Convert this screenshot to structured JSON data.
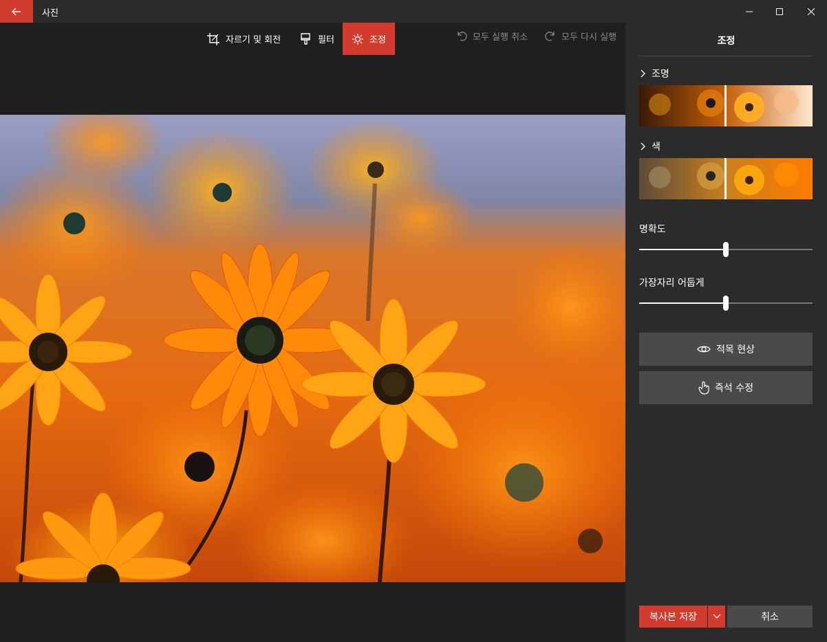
{
  "window": {
    "title": "사진"
  },
  "toolbar": {
    "tabs": [
      {
        "label": "자르기 및 회전",
        "icon": "crop-icon"
      },
      {
        "label": "필터",
        "icon": "brush-icon"
      },
      {
        "label": "조정",
        "icon": "sun-icon",
        "active": true
      }
    ],
    "undo_all": "모두 실행 취소",
    "redo_all": "모두 다시 실행"
  },
  "panel": {
    "title": "조정",
    "sections": [
      {
        "label": "조명",
        "icon": "chevron-right-icon"
      },
      {
        "label": "색",
        "icon": "chevron-right-icon"
      }
    ],
    "sliders": [
      {
        "label": "명확도",
        "value": 50
      },
      {
        "label": "가장자리 어둡게",
        "value": 50
      }
    ],
    "buttons": [
      {
        "label": "적목 현상",
        "icon": "eye-icon"
      },
      {
        "label": "즉석 수정",
        "icon": "touch-icon"
      }
    ],
    "save_copy": "복사본 저장",
    "cancel": "취소"
  },
  "colors": {
    "accent": "#d13c2f",
    "panel_bg": "#2b2b2b",
    "editor_bg": "#1f1f1f",
    "button_bg": "#4a4a4a"
  }
}
